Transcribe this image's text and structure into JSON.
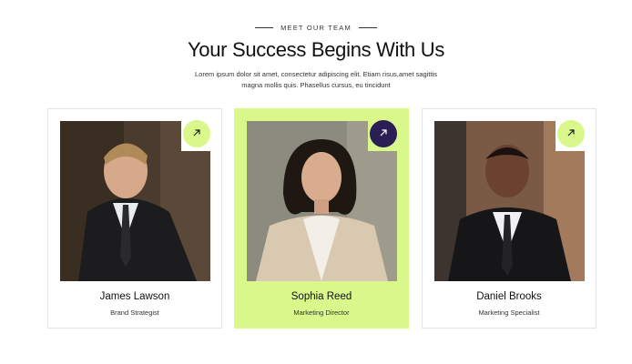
{
  "header": {
    "eyebrow": "MEET OUR TEAM",
    "title": "Your Success Begins With Us",
    "subtitle": "Lorem ipsum dolor sit amet, consectetur adipiscing elit. Etiam risus,amet sagittis magna mollis quis. Phasellus cursus, eu tincidunt"
  },
  "team": [
    {
      "name": "James Lawson",
      "role": "Brand Strategist",
      "photo_icon": "man-portrait-photo",
      "button_icon": "arrow-up-right-icon"
    },
    {
      "name": "Sophia Reed",
      "role": "Marketing Director",
      "photo_icon": "woman-portrait-photo",
      "button_icon": "arrow-up-right-icon"
    },
    {
      "name": "Daniel Brooks",
      "role": "Marketing Specialist",
      "photo_icon": "man-portrait-photo",
      "button_icon": "arrow-up-right-icon"
    }
  ],
  "colors": {
    "accent_lime": "#d9f78b",
    "accent_dark": "#2a1f55",
    "text": "#111111",
    "card_border": "#e4e4e4"
  }
}
